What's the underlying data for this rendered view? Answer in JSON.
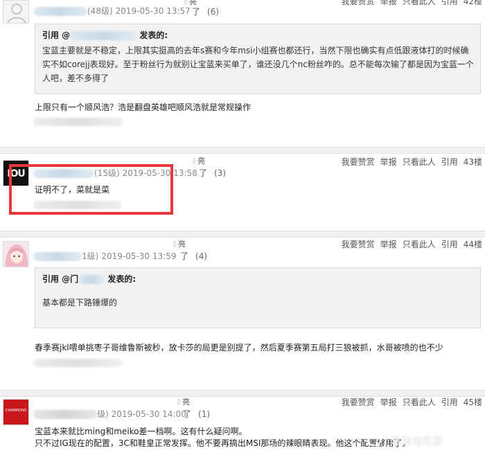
{
  "posts": [
    {
      "level": "(48级)",
      "time": "2019-05-30 13:57",
      "liang": "亮",
      "le": "了",
      "count": "(6)",
      "floor": "42楼",
      "quote": {
        "prefix": "引用 @",
        "suffix": "发表的:",
        "body": "宝蓝主要就是不稳定，上限其实挺高的去年s赛和今年msi小组赛也都还行，当然下限也确实有点低跟液体打的时候确实不如corejj表现好。至于粉丝行为就别让宝蓝来买单了，谁还没几个nc粉丝咋的。总不能每次输了都是因为宝蓝一个人吧，差不多得了"
      },
      "content": "上限只有一个顺风浩？浩是翻盘英雄吧顺风浩就是常规操作"
    },
    {
      "level": "(15级)",
      "time": "2019-05-30 13:58",
      "liang": "亮",
      "le": "了",
      "count": "(3)",
      "floor": "43楼",
      "content": "证明不了，菜就是菜",
      "avatar_text": "IOU"
    },
    {
      "level": "1级)",
      "time": "2019-05-30 13:59",
      "liang": "亮",
      "le": "了",
      "count": "(4)",
      "floor": "44楼",
      "quote": {
        "prefix": "引用 @门",
        "suffix": "发表的:",
        "body": "基本都是下路锤爆的"
      },
      "content": "春季赛jkl喂单挑枣子哥维鲁斯被秒，放卡莎的局更是别提了，然后夏季赛第五局打三狼被抓，水哥被喷的也不少"
    },
    {
      "level": "级)",
      "time": "2019-05-30 14:00",
      "liang": "亮",
      "le": "了",
      "count": "(1)",
      "floor": "45楼",
      "content_lines": [
        "宝蓝本来就比ming和meiko差一档啊。这有什么疑问啊。",
        "只不过IG现在的配置，3C和鞋皇正常发挥。他不要再搞出MSI那场的辣眼睛表现。他这个配置够用了。"
      ],
      "avatar_text": "CHAMPIONS"
    }
  ],
  "actions": {
    "like": "我要赞赏",
    "report": "举报",
    "only_this": "只看此人",
    "cite": "引用"
  },
  "watermark": "/ 激情电竞君",
  "colors": {
    "highlight_box": "#e8383d",
    "quote_bg": "#f2f2f2",
    "separator": "#f0f0f0"
  }
}
